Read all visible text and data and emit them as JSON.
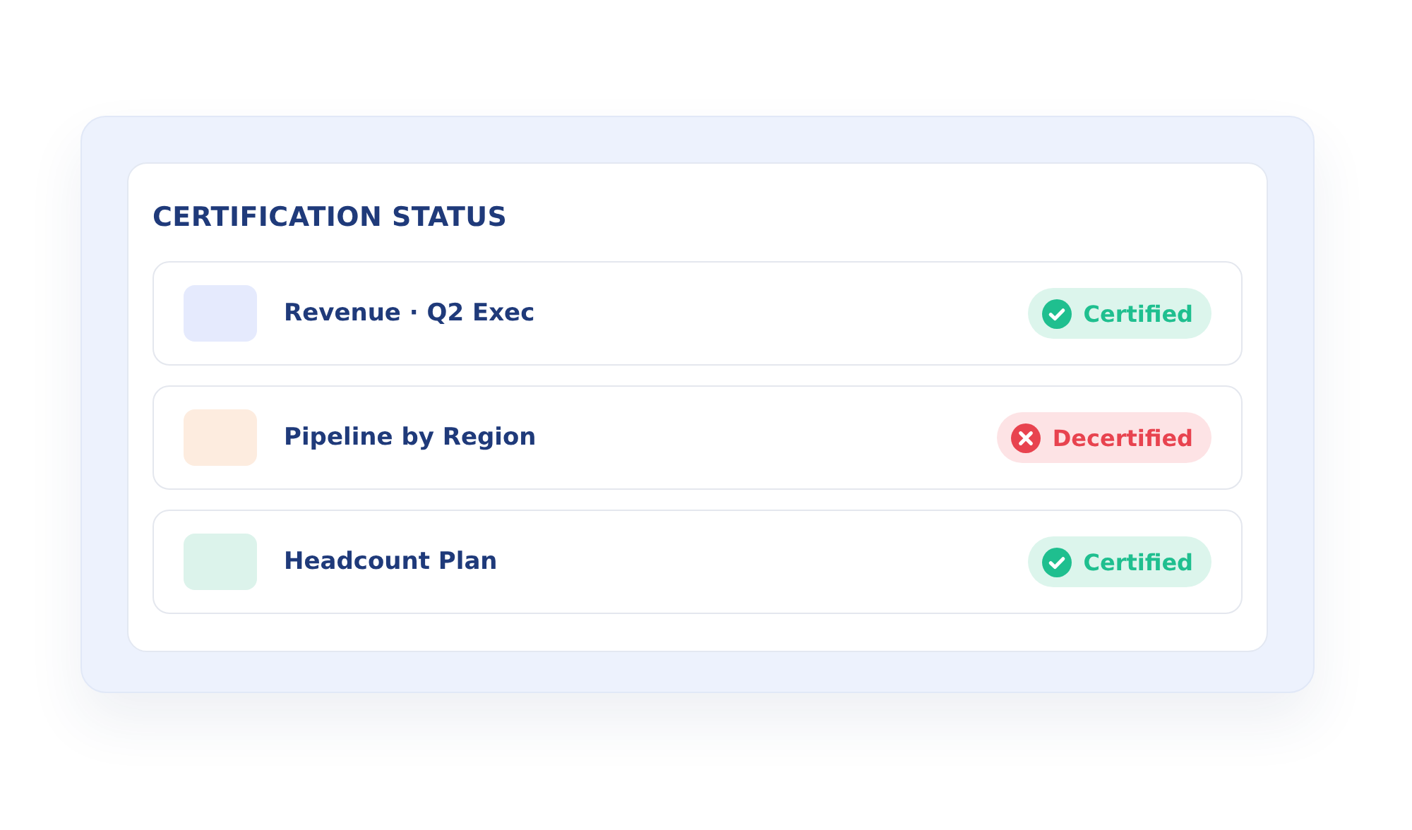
{
  "title": "CERTIFICATION STATUS",
  "items": [
    {
      "name": "Revenue · Q2 Exec",
      "color": "#e5eafd",
      "status": {
        "kind": "certified",
        "label": "Certified"
      }
    },
    {
      "name": "Pipeline by Region",
      "color": "#fdecdf",
      "status": {
        "kind": "decertified",
        "label": "Decertified"
      }
    },
    {
      "name": "Headcount Plan",
      "color": "#dcf3eb",
      "status": {
        "kind": "certified",
        "label": "Certified"
      }
    }
  ]
}
